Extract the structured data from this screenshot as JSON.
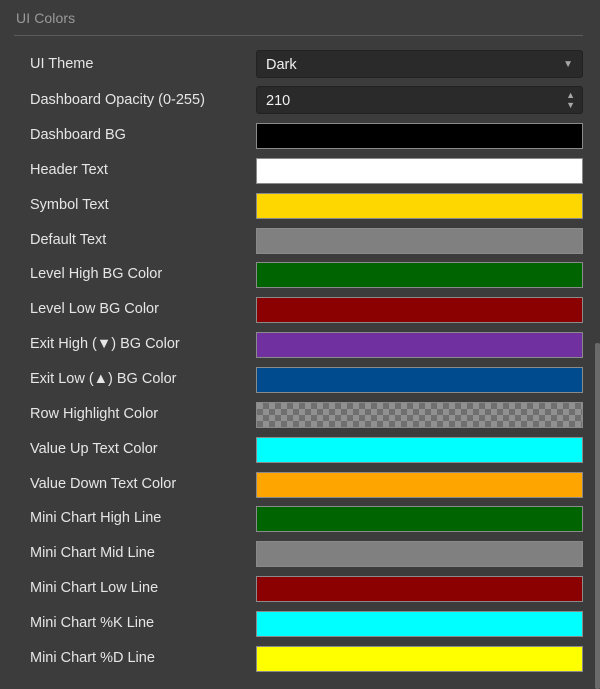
{
  "section": {
    "title": "UI Colors"
  },
  "ui_theme": {
    "label": "UI Theme",
    "value": "Dark",
    "arrow_icon": "dropdown-arrow-icon"
  },
  "dashboard_opacity": {
    "label": "Dashboard Opacity (0-255)",
    "value": "210"
  },
  "colors": [
    {
      "label": "Dashboard BG",
      "color": "#000000"
    },
    {
      "label": "Header Text",
      "color": "#ffffff"
    },
    {
      "label": "Symbol Text",
      "color": "#ffd700"
    },
    {
      "label": "Default Text",
      "color": "#808080"
    },
    {
      "label": "Level High BG Color",
      "color": "#006400"
    },
    {
      "label": "Level Low BG Color",
      "color": "#8b0000"
    },
    {
      "label": "Exit High (▼) BG Color",
      "color": "#7030a0"
    },
    {
      "label": "Exit Low (▲) BG Color",
      "color": "#004b8d"
    },
    {
      "label": "Row Highlight Color",
      "color": "transparent"
    },
    {
      "label": "Value Up Text Color",
      "color": "#00ffff"
    },
    {
      "label": "Value Down Text Color",
      "color": "#ffa500"
    },
    {
      "label": "Mini Chart High Line",
      "color": "#006400"
    },
    {
      "label": "Mini Chart Mid Line",
      "color": "#808080"
    },
    {
      "label": "Mini Chart Low Line",
      "color": "#8b0000"
    },
    {
      "label": "Mini Chart %K Line",
      "color": "#00ffff"
    },
    {
      "label": "Mini Chart %D Line",
      "color": "#ffff00"
    }
  ]
}
